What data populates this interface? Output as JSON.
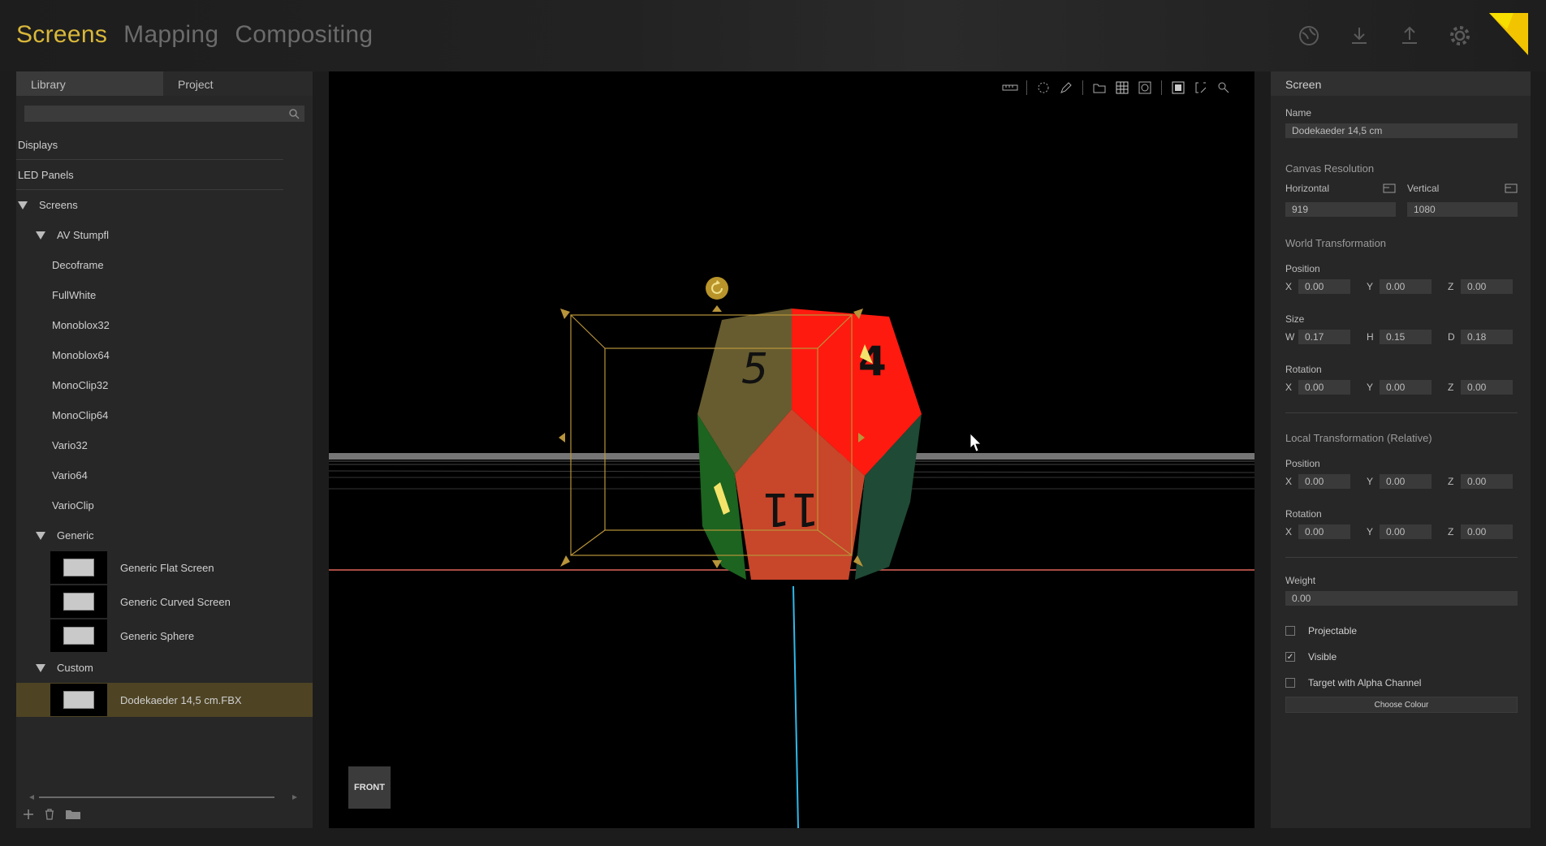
{
  "nav": {
    "tabs": [
      "Screens",
      "Mapping",
      "Compositing"
    ],
    "active": "Screens"
  },
  "colors": {
    "accent": "#d9b73a",
    "selected": "#4e4424",
    "panel": "#272727"
  },
  "library": {
    "tabs": [
      "Library",
      "Project"
    ],
    "search_placeholder": "",
    "tree": {
      "displays": "Displays",
      "led_panels": "LED Panels",
      "screens": "Screens",
      "av_stumpfl": "AV Stumpfl",
      "av_items": [
        "Decoframe",
        "FullWhite",
        "Monoblox32",
        "Monoblox64",
        "MonoClip32",
        "MonoClip64",
        "Vario32",
        "Vario64",
        "VarioClip"
      ],
      "generic": "Generic",
      "generic_items": [
        "Generic Flat Screen",
        "Generic Curved Screen",
        "Generic Sphere"
      ],
      "custom": "Custom",
      "custom_items": [
        "Dodekaeder 14,5 cm.FBX"
      ]
    }
  },
  "viewport": {
    "view_label": "FRONT",
    "faces": [
      "5",
      "4",
      "11"
    ]
  },
  "screen": {
    "header": "Screen",
    "name_label": "Name",
    "name_value": "Dodekaeder 14,5 cm",
    "canvas_resolution": "Canvas Resolution",
    "horizontal_label": "Horizontal",
    "vertical_label": "Vertical",
    "horizontal": "919",
    "vertical": "1080",
    "world_transformation": "World Transformation",
    "position_label": "Position",
    "size_label": "Size",
    "rotation_label": "Rotation",
    "world": {
      "position": {
        "x": "0.00",
        "y": "0.00",
        "z": "0.00"
      },
      "size": {
        "w": "0.17",
        "h": "0.15",
        "d": "0.18"
      },
      "rotation": {
        "x": "0.00",
        "y": "0.00",
        "z": "0.00"
      }
    },
    "local_transformation": "Local Transformation (Relative)",
    "local": {
      "position": {
        "x": "0.00",
        "y": "0.00",
        "z": "0.00"
      },
      "rotation": {
        "x": "0.00",
        "y": "0.00",
        "z": "0.00"
      }
    },
    "weight_label": "Weight",
    "weight": "0.00",
    "projectable_label": "Projectable",
    "projectable": false,
    "visible_label": "Visible",
    "visible": true,
    "alpha_label": "Target with Alpha Channel",
    "alpha": false,
    "choose_colour": "Choose Colour"
  },
  "axis_labels": {
    "x": "X",
    "y": "Y",
    "z": "Z",
    "w": "W",
    "h": "H",
    "d": "D"
  }
}
